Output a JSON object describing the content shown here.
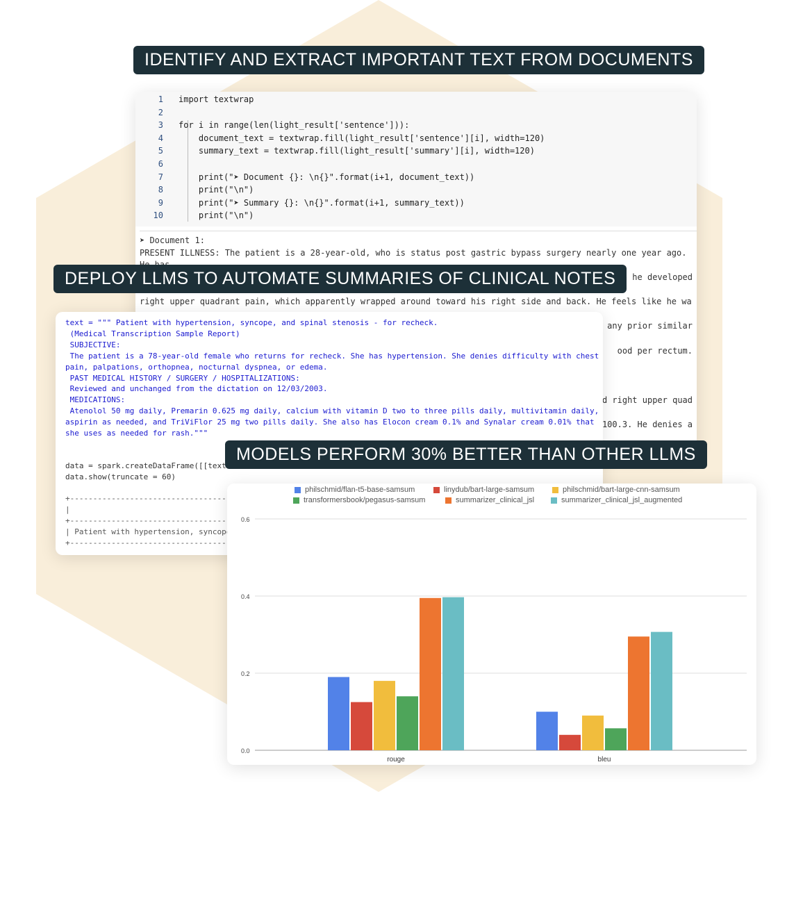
{
  "banners": {
    "top": "IDENTIFY AND EXTRACT IMPORTANT TEXT FROM DOCUMENTS",
    "middle": "DEPLOY LLMS TO AUTOMATE SUMMARIES OF CLINICAL NOTES",
    "bottom": "MODELS PERFORM 30% BETTER THAN OTHER LLMS"
  },
  "colors": {
    "banner_bg": "#1d3038",
    "hexagon": "#f8ecd6",
    "keyword": "#2b3bd6",
    "string": "#c9372c"
  },
  "code_cell_1": {
    "line_numbers": [
      "1",
      "2",
      "3",
      "4",
      "5",
      "6",
      "7",
      "8",
      "9",
      "10"
    ],
    "lines": [
      "import textwrap",
      "",
      "for i in range(len(light_result['sentence'])):",
      "    document_text = textwrap.fill(light_result['sentence'][i], width=120)",
      "    summary_text = textwrap.fill(light_result['summary'][i], width=120)",
      "",
      "    print(\"➤ Document {}: \\n{}\".format(i+1, document_text))",
      "    print(\"\\n\")",
      "    print(\"➤ Summary {}: \\n{}\".format(i+1, summary_text))",
      "    print(\"\\n\")"
    ],
    "output": [
      "➤ Document 1:",
      "PRESENT ILLNESS: The patient is a 28-year-old, who is status post gastric bypass surgery nearly one year ago.",
      "He has",
      "when he developed",
      "right upper quadrant pain, which apparently wrapped around toward his right side and back. He feels like he wa",
      "any prior similar",
      "ood per rectum.",
      "nd right upper quad",
      "100.3. He denies a"
    ]
  },
  "code_cell_2": {
    "text_lines": [
      "text = \"\"\" Patient with hypertension, syncope, and spinal stenosis - for recheck.",
      " (Medical Transcription Sample Report)",
      " SUBJECTIVE:",
      " The patient is a 78-year-old female who returns for recheck. She has hypertension. She denies difficulty with chest",
      "pain, palpations, orthopnea, nocturnal dyspnea, or edema.",
      " PAST MEDICAL HISTORY / SURGERY / HOSPITALIZATIONS:",
      " Reviewed and unchanged from the dictation on 12/03/2003.",
      " MEDICATIONS:",
      " Atenolol 50 mg daily, Premarin 0.625 mg daily, calcium with vitamin D two to three pills daily, multivitamin daily,",
      "aspirin as needed, and TriViFlor 25 mg two pills daily. She also has Elocon cream 0.1% and Synalar cream 0.01% that",
      "she uses as needed for rash.\"\"\""
    ],
    "code_lines": [
      "data = spark.createDataFrame([[text",
      "data.show(truncate = 60)"
    ],
    "table_lines": [
      "+--------------------------------------------",
      "|",
      "+--------------------------------------------",
      "| Patient with hypertension, syncope",
      "+--------------------------------------------"
    ]
  },
  "chart_data": {
    "type": "bar",
    "categories": [
      "rouge",
      "bleu"
    ],
    "ylim": [
      0,
      0.6
    ],
    "yticks": [
      "0.0",
      "0.2",
      "0.4",
      "0.6"
    ],
    "grid": true,
    "legend_position": "top",
    "series": [
      {
        "name": "philschmid/flan-t5-base-samsum",
        "color": "#5282e8",
        "values": [
          0.19,
          0.1
        ]
      },
      {
        "name": "linydub/bart-large-samsum",
        "color": "#d6493b",
        "values": [
          0.125,
          0.04
        ]
      },
      {
        "name": "philschmid/bart-large-cnn-samsum",
        "color": "#f1bd3d",
        "values": [
          0.18,
          0.09
        ]
      },
      {
        "name": "transformersbook/pegasus-samsum",
        "color": "#4ea55a",
        "values": [
          0.14,
          0.057
        ]
      },
      {
        "name": "summarizer_clinical_jsl",
        "color": "#ed7530",
        "values": [
          0.395,
          0.295
        ]
      },
      {
        "name": "summarizer_clinical_jsl_augmented",
        "color": "#6abdc4",
        "values": [
          0.397,
          0.307
        ]
      }
    ]
  }
}
